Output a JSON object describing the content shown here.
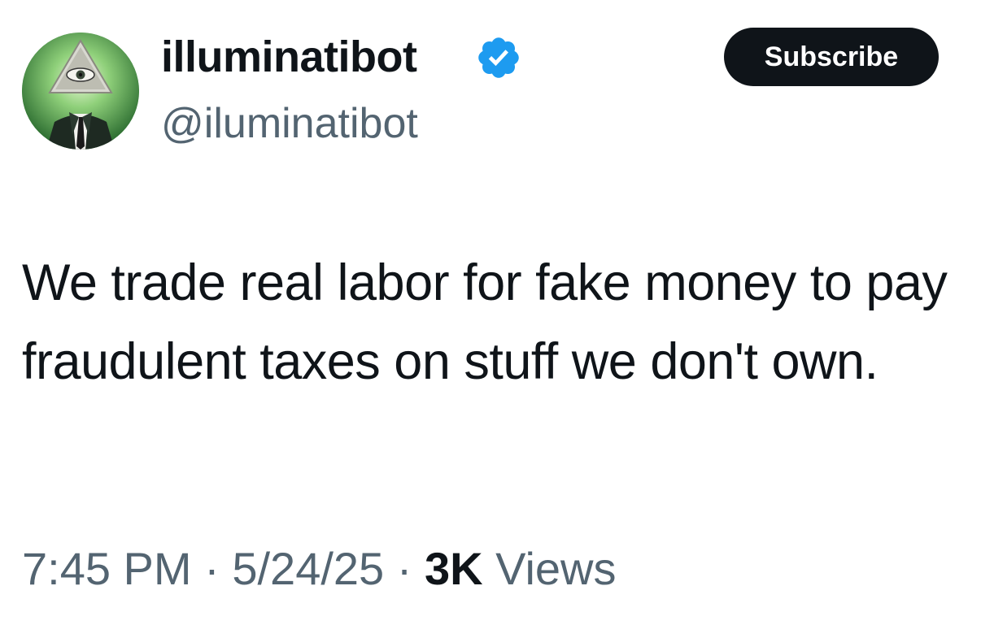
{
  "author": {
    "display_name": "illuminatibot",
    "handle": "@iluminatibot",
    "avatar_icon": "illuminati-eye-avatar",
    "verified_icon": "verified-badge-icon",
    "verified_color": "#1d9bf0"
  },
  "subscribe_label": "Subscribe",
  "tweet": {
    "text": "We trade real labor for fake money to pay fraudulent taxes on stuff we don't own."
  },
  "meta": {
    "time": "7:45 PM",
    "separator": "·",
    "date": "5/24/25",
    "views_count": "3K",
    "views_label": "Views"
  },
  "colors": {
    "text_primary": "#0f1419",
    "text_secondary": "#536471",
    "button_bg": "#0f1419",
    "button_text": "#ffffff"
  }
}
